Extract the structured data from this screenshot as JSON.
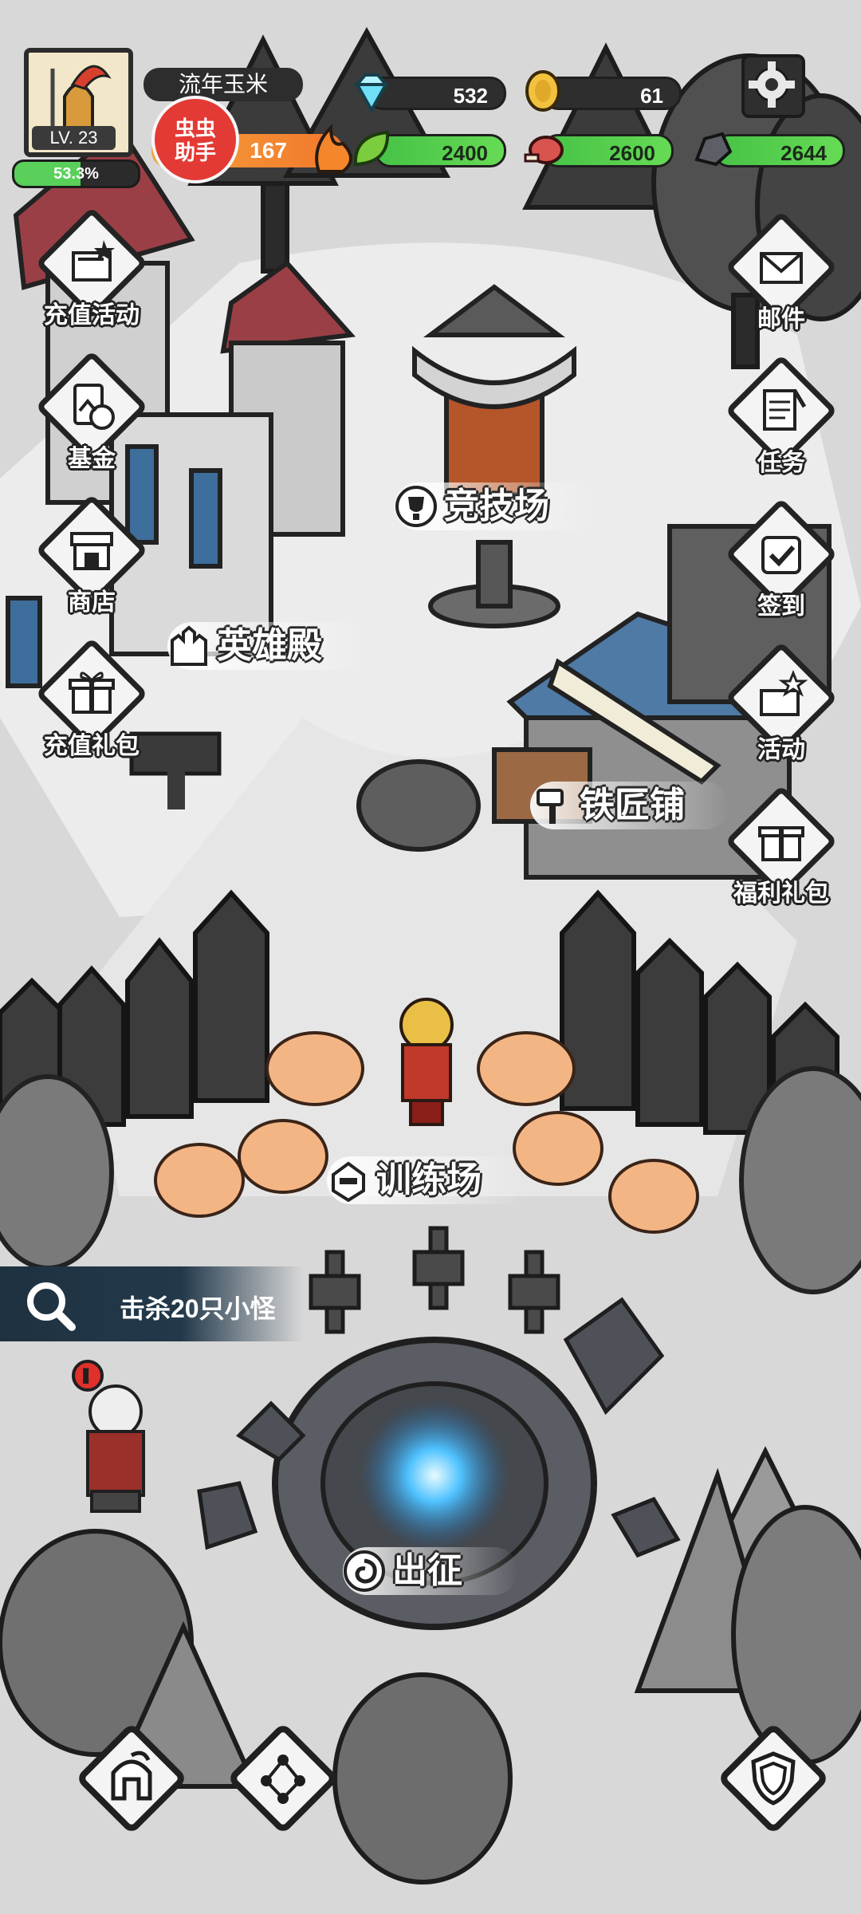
{
  "player": {
    "name": "流年玉米",
    "level": "LV. 23",
    "exp_percent": "53.3%",
    "exp_fraction": 0.533,
    "power": "167"
  },
  "badge": {
    "line1": "虫虫",
    "line2": "助手"
  },
  "resources": {
    "diamonds": "532",
    "gold": "61",
    "leaf": "2400",
    "meat": "2600",
    "ore": "2644"
  },
  "left_menu": [
    {
      "label": "充值活动",
      "icon": "recharge-event-icon"
    },
    {
      "label": "基金",
      "icon": "fund-icon"
    },
    {
      "label": "商店",
      "icon": "shop-icon"
    },
    {
      "label": "充值礼包",
      "icon": "gift-pack-icon"
    }
  ],
  "right_menu": [
    {
      "label": "邮件",
      "icon": "mail-icon"
    },
    {
      "label": "任务",
      "icon": "task-scroll-icon"
    },
    {
      "label": "签到",
      "icon": "checkin-icon"
    },
    {
      "label": "活动",
      "icon": "event-icon"
    },
    {
      "label": "福利礼包",
      "icon": "welfare-gift-icon"
    }
  ],
  "buildings": {
    "arena": "竞技场",
    "hero_hall": "英雄殿",
    "blacksmith": "铁匠铺",
    "training": "训练场",
    "expedition": "出征"
  },
  "quest": {
    "text": "击杀20只小怪"
  },
  "bottom_nav": [
    {
      "icon": "hero-helmet-icon"
    },
    {
      "icon": "skill-tree-icon"
    },
    {
      "icon": "shield-icon"
    }
  ],
  "colors": {
    "exp_green": "#58d05a",
    "resource_green": "#55d24e",
    "badge_red": "#e33a35",
    "portal_blue": "#38a9ff"
  }
}
